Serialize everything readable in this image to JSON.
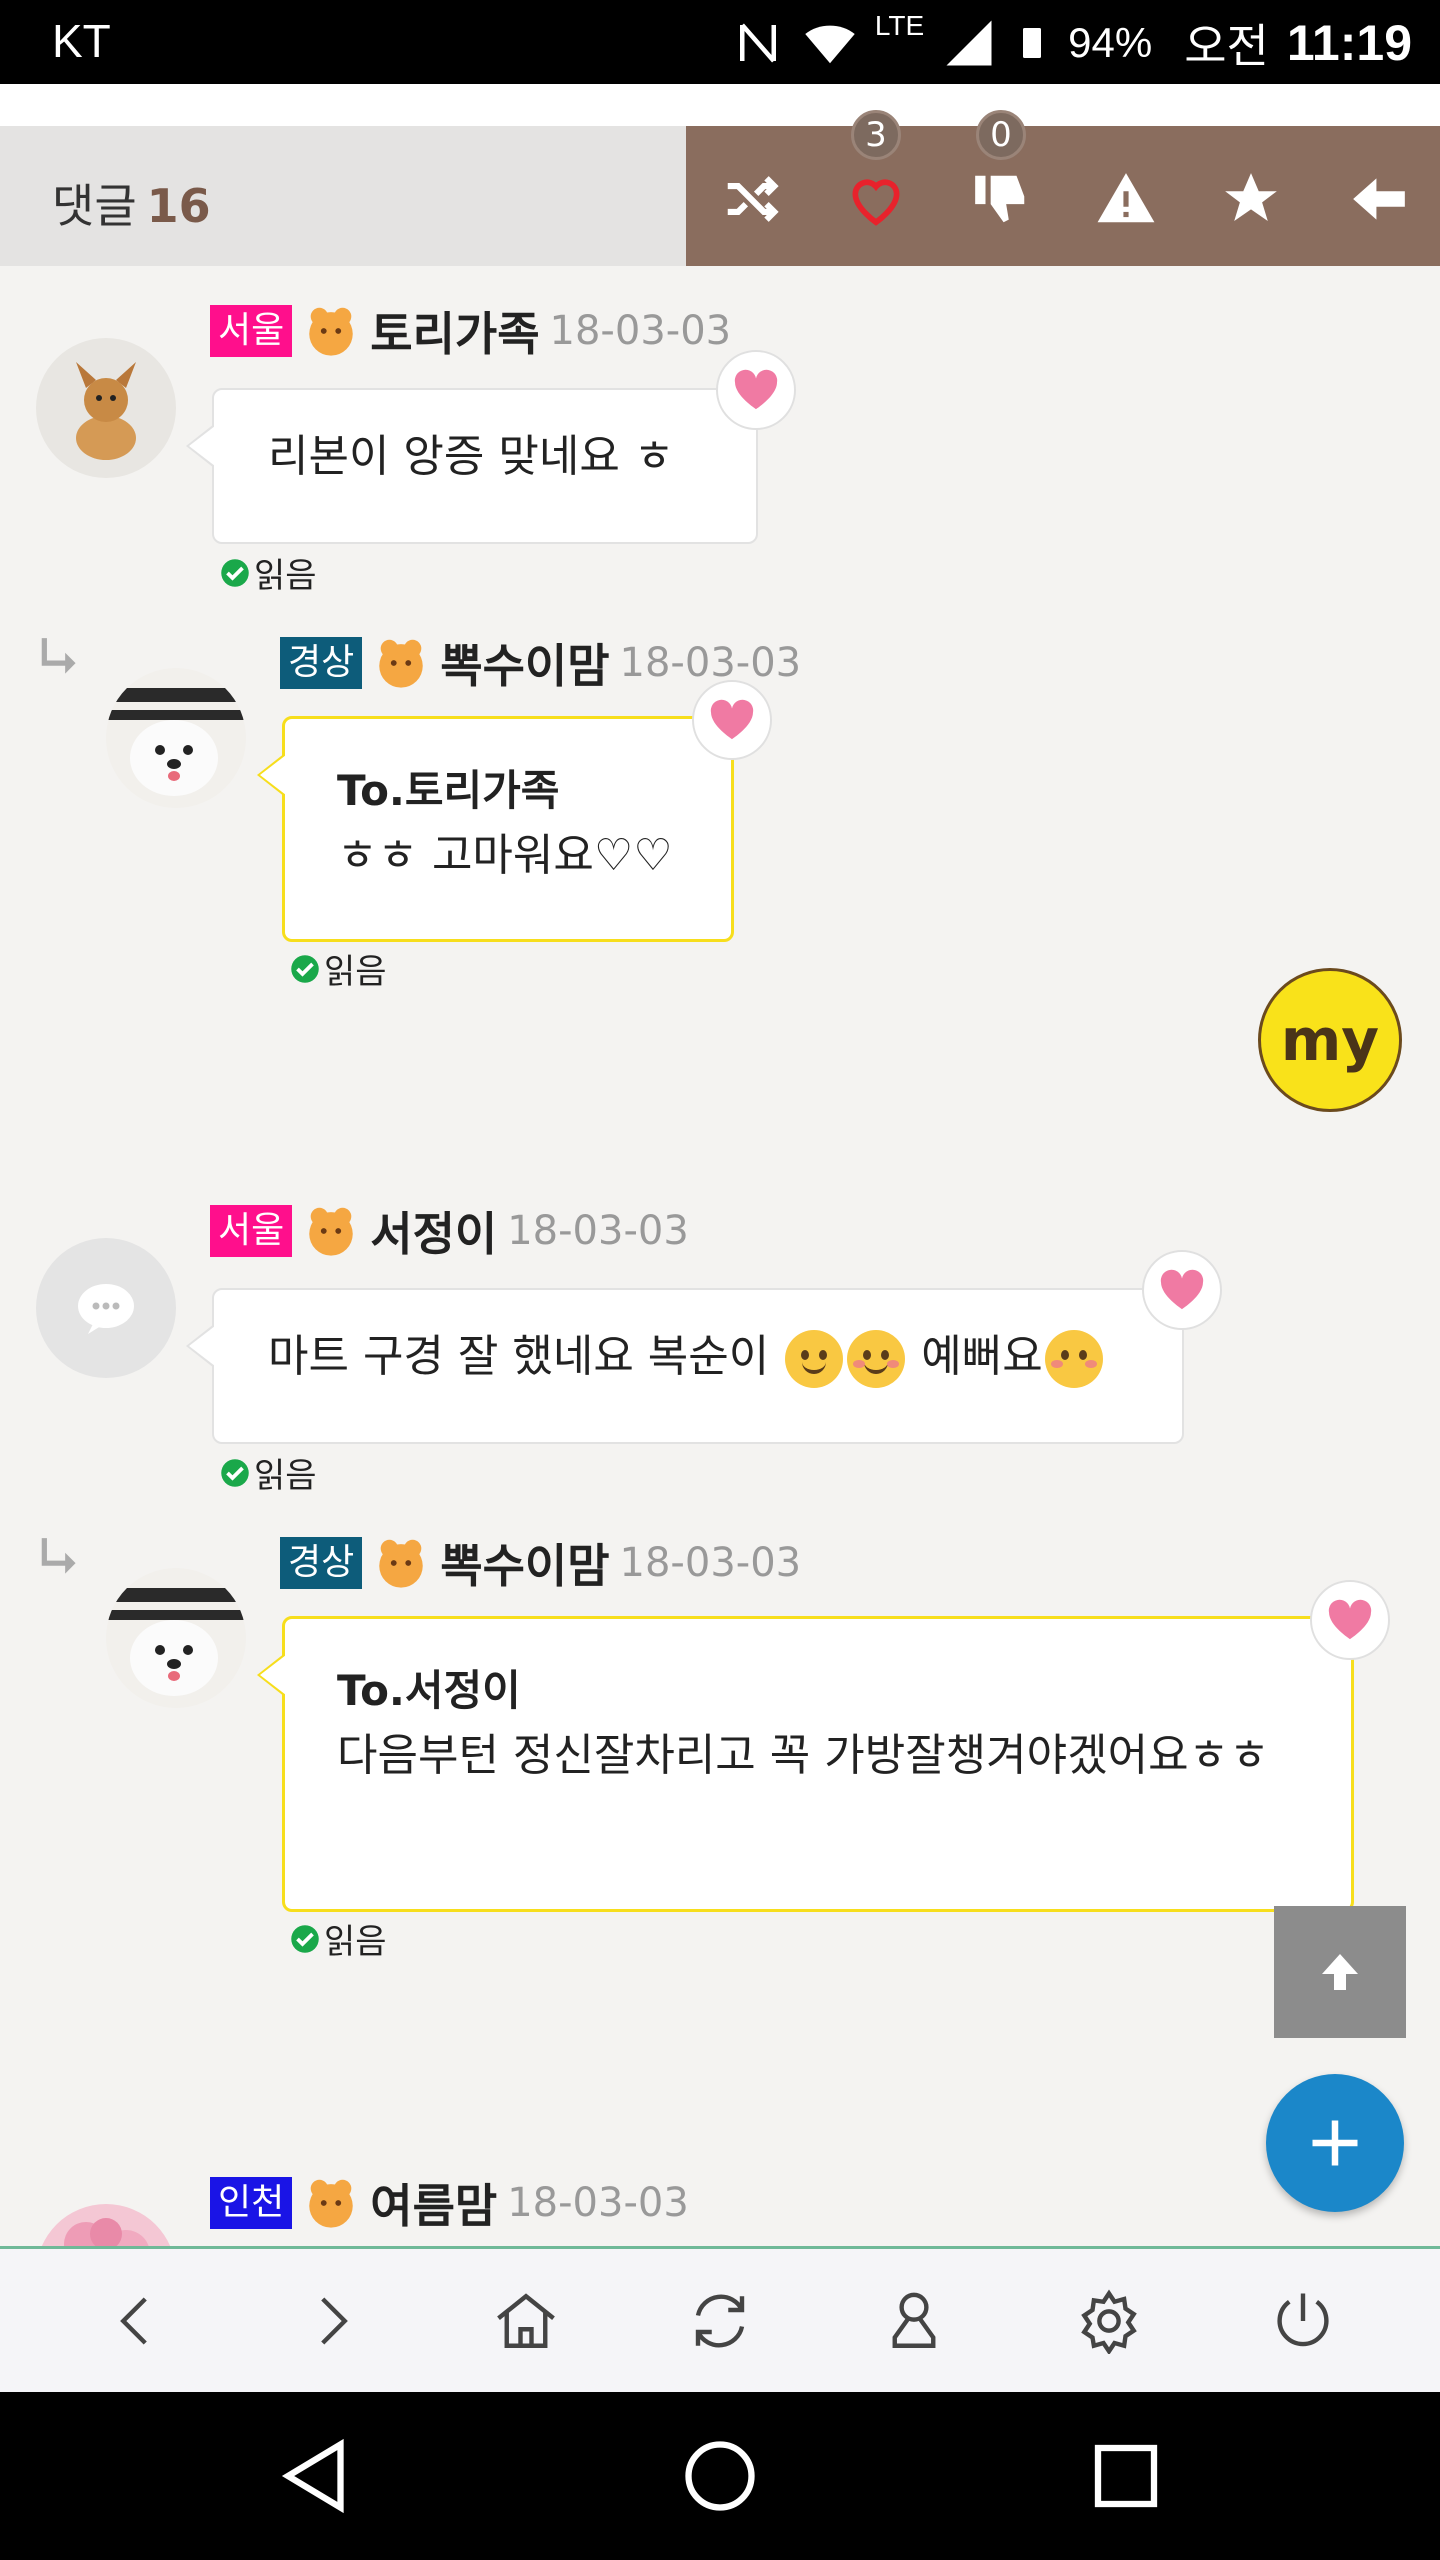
{
  "status_bar": {
    "carrier": "KT",
    "network": "LTE",
    "battery_percent": "94%",
    "ampm": "오전",
    "time": "11:19"
  },
  "comment_header": {
    "label": "댓글",
    "count": "16",
    "like_count": "3",
    "dislike_count": "0",
    "colors": {
      "left_bg": "#e4e3e2",
      "right_bg": "#8a6d5e"
    }
  },
  "comments": [
    {
      "region": "서울",
      "region_color": "#ff0f8c",
      "nickname": "토리가족",
      "date": "18-03-03",
      "text": "리본이 앙증 맞네요 ㅎ",
      "read_label": "읽음",
      "avatar": "chihuahua-photo"
    },
    {
      "region": "경상",
      "region_color": "#0d5c7a",
      "nickname": "뽁수이맘",
      "date": "18-03-03",
      "to": "To.토리가족",
      "text": "ㅎㅎ 고마워요♡♡",
      "read_label": "읽음",
      "avatar": "white-dog-photo"
    },
    {
      "region": "서울",
      "region_color": "#ff0f8c",
      "nickname": "서정이",
      "date": "18-03-03",
      "text": "마트 구경 잘 했네요 복순이",
      "text_tail": "예뻐요",
      "read_label": "읽음",
      "avatar": "default-chat-avatar"
    },
    {
      "region": "경상",
      "region_color": "#0d5c7a",
      "nickname": "뽁수이맘",
      "date": "18-03-03",
      "to": "To.서정이",
      "text": "다음부턴 정신잘차리고 꼭 가방잘챙겨야겠어요ㅎㅎ",
      "read_label": "읽음",
      "avatar": "white-dog-photo"
    },
    {
      "region": "인천",
      "region_color": "#1a14e6",
      "nickname": "여름맘",
      "date": "18-03-03",
      "avatar": "flower-photo"
    }
  ],
  "floating": {
    "my_label": "my"
  },
  "icons": [
    "shuffle-icon",
    "heart-outline-icon",
    "thumbs-down-icon",
    "warning-icon",
    "star-icon",
    "back-arrow-icon",
    "heart-icon",
    "check-circle-icon",
    "reply-arrow-icon",
    "scroll-top-icon",
    "plus-icon",
    "chevron-left-icon",
    "chevron-right-icon",
    "home-icon",
    "refresh-icon",
    "person-icon",
    "gear-icon",
    "power-icon"
  ]
}
